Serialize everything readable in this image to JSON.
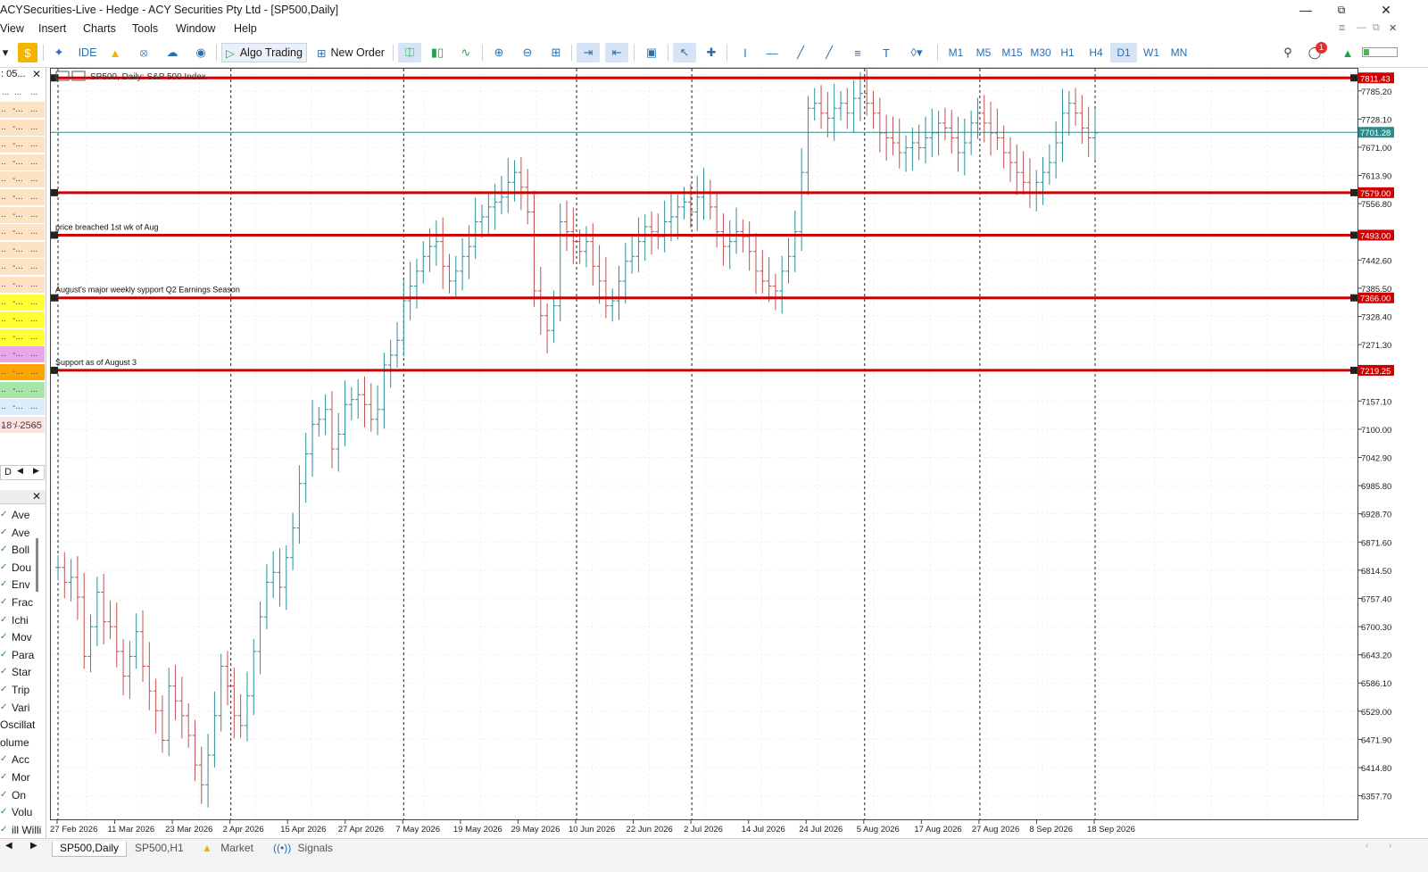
{
  "window": {
    "title": "ACYSecurities-Live - Hedge - ACY Securities Pty Ltd - [SP500,Daily]"
  },
  "menu": [
    "View",
    "Insert",
    "Charts",
    "Tools",
    "Window",
    "Help"
  ],
  "toolbar": {
    "ide": "IDE",
    "algo_trading": "Algo Trading",
    "new_order": "New Order",
    "timeframes": [
      "M1",
      "M5",
      "M15",
      "M30",
      "H1",
      "H4",
      "D1",
      "W1",
      "MN"
    ],
    "active_timeframe": "D1",
    "notification_count": "1"
  },
  "market_watch": {
    "header": ": 05...",
    "counter": "18 / 2565",
    "row_colors": [
      "#fde2c4",
      "#fde2c4",
      "#fde2c4",
      "#fde2c4",
      "#fde2c4",
      "#fde2c4",
      "#fde2c4",
      "#fde2c4",
      "#fde2c4",
      "#fde2c4",
      "#fde2c4",
      "#ffff33",
      "#ffff33",
      "#ffff33",
      "#e9a6e9",
      "#ffa500",
      "#a6e6a6",
      "#dcecfc",
      "#fde4e4"
    ]
  },
  "navigator": {
    "items": [
      "Ave",
      "Ave",
      "Boll",
      "Dou",
      "Env",
      "Frac",
      "Ichi",
      "Mov",
      "Para",
      "Star",
      "Trip",
      "Vari",
      "Oscillat",
      "olume",
      "Acc",
      "Mor",
      "On",
      "Volu",
      "ill Willi"
    ],
    "tab_label": "D"
  },
  "chart": {
    "title": "SP500, Daily:  S&P 500 Index",
    "annotations": [
      {
        "text": "price breached 1st wk of Aug",
        "price": 7493.0
      },
      {
        "text": "August's major weekly sypport Q2 Earnings Season",
        "price": 7366.0
      },
      {
        "text": "Support as of August 3",
        "price": 7219.25
      }
    ],
    "current_price": "7701.28"
  },
  "chart_data": {
    "type": "ohlc",
    "title": "SP500, Daily:  S&P 500 Index",
    "ylim": [
      6310,
      7830
    ],
    "price_ticks": [
      "7785.20",
      "7728.10",
      "7671.00",
      "7613.90",
      "7556.80",
      "7442.60",
      "7385.50",
      "7328.40",
      "7271.30",
      "7157.10",
      "7100.00",
      "7042.90",
      "6985.80",
      "6928.70",
      "6871.60",
      "6814.50",
      "6757.40",
      "6700.30",
      "6643.20",
      "6586.10",
      "6529.00",
      "6471.90",
      "6414.80",
      "6357.70"
    ],
    "horizontal_lines": [
      {
        "price": 7811.43,
        "label": "7811.43",
        "color": "#cc0000"
      },
      {
        "price": 7579.0,
        "label": "7579.00",
        "color": "#cc0000"
      },
      {
        "price": 7493.0,
        "label": "7493.00",
        "color": "#cc0000"
      },
      {
        "price": 7366.0,
        "label": "7366.00",
        "color": "#cc0000"
      },
      {
        "price": 7219.25,
        "label": "7219.25",
        "color": "#cc0000"
      }
    ],
    "current_price": {
      "price": 7701.28,
      "label": "7701.28",
      "color": "#2e8b8b"
    },
    "date_labels": [
      "27 Feb 2026",
      "11 Mar 2026",
      "23 Mar 2026",
      "2 Apr 2026",
      "15 Apr 2026",
      "27 Apr 2026",
      "7 May 2026",
      "19 May 2026",
      "29 May 2026",
      "10 Jun 2026",
      "22 Jun 2026",
      "2 Jul 2026",
      "14 Jul 2026",
      "24 Jul 2026",
      "5 Aug 2026",
      "17 Aug 2026",
      "27 Aug 2026",
      "8 Sep 2026",
      "18 Sep 2026"
    ],
    "separators_after_label_index": [
      0,
      3,
      6,
      9,
      11,
      14,
      16,
      18
    ],
    "closes": [
      6820,
      6790,
      6800,
      6760,
      6640,
      6700,
      6770,
      6710,
      6700,
      6650,
      6600,
      6640,
      6690,
      6620,
      6570,
      6530,
      6470,
      6580,
      6550,
      6520,
      6480,
      6420,
      6380,
      6440,
      6520,
      6620,
      6580,
      6520,
      6500,
      6560,
      6650,
      6720,
      6790,
      6810,
      6780,
      6840,
      6900,
      6990,
      7050,
      7110,
      7120,
      7140,
      7060,
      7090,
      7150,
      7160,
      7170,
      7150,
      7120,
      7140,
      7230,
      7250,
      7280,
      7360,
      7390,
      7420,
      7450,
      7470,
      7480,
      7430,
      7400,
      7420,
      7450,
      7470,
      7520,
      7530,
      7550,
      7560,
      7570,
      7600,
      7620,
      7590,
      7540,
      7380,
      7330,
      7300,
      7350,
      7520,
      7500,
      7480,
      7460,
      7480,
      7430,
      7400,
      7350,
      7360,
      7400,
      7440,
      7450,
      7480,
      7510,
      7500,
      7490,
      7520,
      7530,
      7550,
      7560,
      7540,
      7570,
      7580,
      7550,
      7500,
      7470,
      7480,
      7500,
      7490,
      7460,
      7420,
      7400,
      7390,
      7380,
      7420,
      7450,
      7500,
      7620,
      7750,
      7760,
      7740,
      7730,
      7750,
      7760,
      7740,
      7770,
      7780,
      7760,
      7740,
      7700,
      7690,
      7680,
      7660,
      7670,
      7680,
      7670,
      7690,
      7700,
      7720,
      7710,
      7690,
      7660,
      7680,
      7720,
      7740,
      7720,
      7700,
      7690,
      7660,
      7640,
      7620,
      7600,
      7580,
      7600,
      7620,
      7640,
      7680,
      7740,
      7760,
      7740,
      7710,
      7690,
      7700
    ]
  },
  "tabs": [
    "SP500,Daily",
    "SP500,H1",
    "Market",
    "Signals"
  ]
}
